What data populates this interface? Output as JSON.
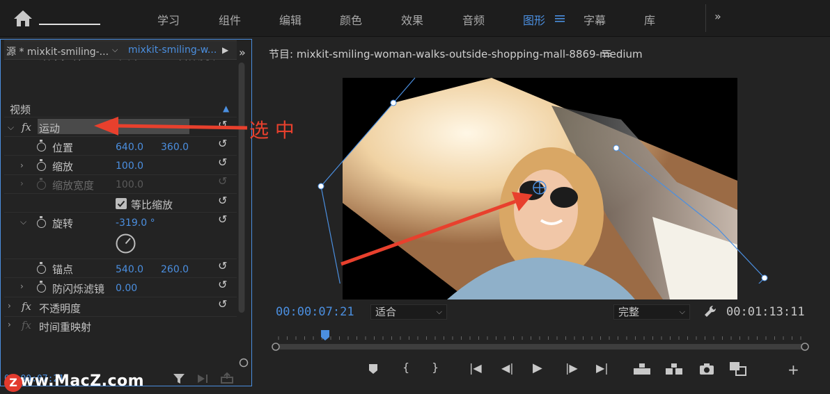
{
  "workspace": {
    "tabs": [
      "学习",
      "组件",
      "编辑",
      "颜色",
      "效果",
      "音频",
      "图形",
      "字幕",
      "库"
    ],
    "active_tab": "图形",
    "more": "»"
  },
  "effects_panel": {
    "tabs": [
      "效果控件",
      "文本",
      "音频剪辑"
    ],
    "more": "»",
    "source_label": "源 * mixkit-smiling-...",
    "sequence_label": "mixkit-smiling-w...",
    "section_video": "视频",
    "motion": "运动",
    "position": {
      "label": "位置",
      "x": "640.0",
      "y": "360.0"
    },
    "scale": {
      "label": "缩放",
      "value": "100.0"
    },
    "scale_width": {
      "label": "缩放宽度",
      "value": "100.0"
    },
    "uniform_scale": "等比缩放",
    "rotation": {
      "label": "旋转",
      "value": "-319.0 °"
    },
    "anchor": {
      "label": "锚点",
      "x": "540.0",
      "y": "260.0"
    },
    "anti_flicker": {
      "label": "防闪烁滤镜",
      "value": "0.00"
    },
    "opacity": "不透明度",
    "time_remap": "时间重映射",
    "fx": "fx",
    "timecode_partial": "00:00:07:21"
  },
  "annotation": {
    "label": "选 中",
    "color": "#e8402d"
  },
  "program_monitor": {
    "title": "节目: mixkit-smiling-woman-walks-outside-shopping-mall-8869-medium",
    "timecode_current": "00:00:07:21",
    "fit": "适合",
    "quality": "完整",
    "timecode_total": "00:01:13:11"
  },
  "watermark": "www.MacZ.com",
  "colors": {
    "accent": "#4b8fe0",
    "annotation": "#e8402d",
    "panel": "#232323"
  }
}
